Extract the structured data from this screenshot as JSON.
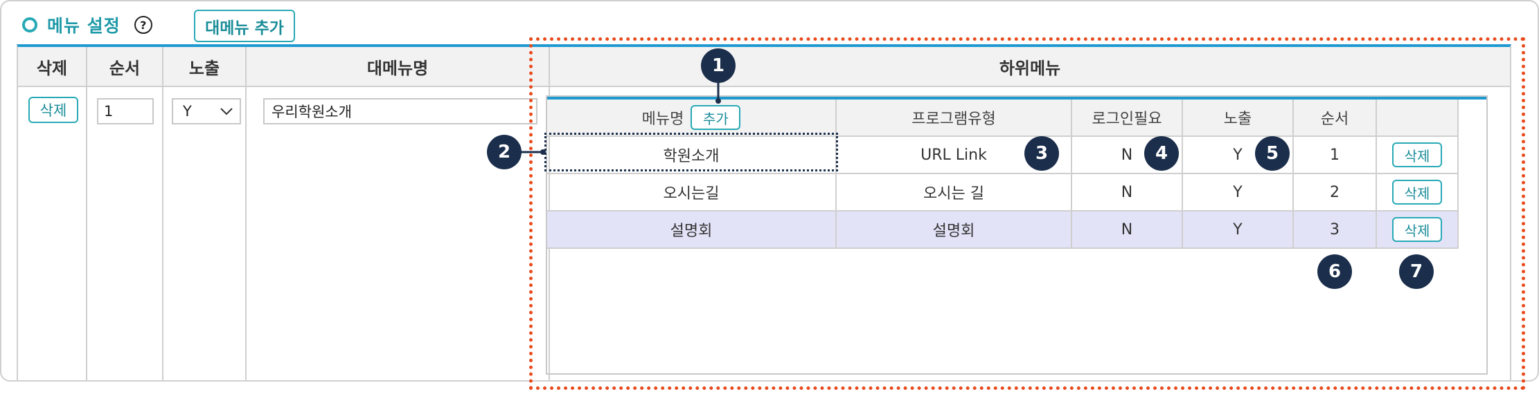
{
  "section": {
    "title": "메뉴 설정",
    "help_icon_glyph": "?",
    "add_main_button": "대메뉴 추가"
  },
  "main_table": {
    "headers": [
      "삭제",
      "순서",
      "노출",
      "대메뉴명",
      "하위메뉴"
    ],
    "row": {
      "delete_label": "삭제",
      "order": "1",
      "visibility": "Y",
      "name": "우리학원소개"
    }
  },
  "sub_table": {
    "headers": [
      "메뉴명",
      "프로그램유형",
      "로그인필요",
      "노출",
      "순서",
      ""
    ],
    "add_label": "추가",
    "rows": [
      {
        "name": "학원소개",
        "program": "URL Link",
        "login": "N",
        "visible": "Y",
        "order": "1",
        "delete": "삭제"
      },
      {
        "name": "오시는길",
        "program": "오시는 길",
        "login": "N",
        "visible": "Y",
        "order": "2",
        "delete": "삭제"
      },
      {
        "name": "설명회",
        "program": "설명회",
        "login": "N",
        "visible": "Y",
        "order": "3",
        "delete": "삭제"
      }
    ]
  },
  "callouts": [
    "1",
    "2",
    "3",
    "4",
    "5",
    "6",
    "7"
  ],
  "colors": {
    "accent": "#27a9b5",
    "header_line": "#1f9ad0",
    "highlight_row": "#e3e3f8",
    "callout": "#1b2e4b",
    "dashed_box": "#e84a1c"
  }
}
